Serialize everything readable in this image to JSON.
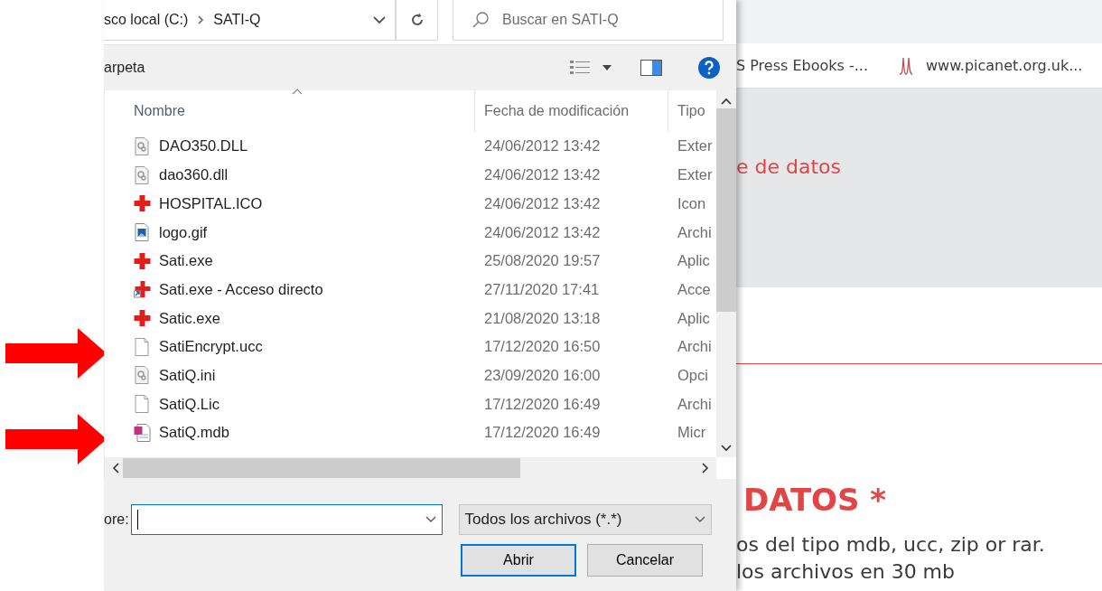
{
  "address_bar": {
    "breadcrumbs": [
      "sco local (C:)",
      "SATI-Q"
    ]
  },
  "search": {
    "placeholder": "Buscar en SATI-Q"
  },
  "toolbar": {
    "label": "arpeta"
  },
  "file_list": {
    "columns": [
      "Nombre",
      "Fecha de modificación",
      "Tipo"
    ],
    "rows": [
      {
        "name": "DAO350.DLL",
        "modified": "24/06/2012 13:42",
        "type": "Exter",
        "kind": "settings-file",
        "marked": false
      },
      {
        "name": "dao360.dll",
        "modified": "24/06/2012 13:42",
        "type": "Exter",
        "kind": "settings-file",
        "marked": false
      },
      {
        "name": "HOSPITAL.ICO",
        "modified": "24/06/2012 13:42",
        "type": "Icon",
        "kind": "cross",
        "marked": false
      },
      {
        "name": "logo.gif",
        "modified": "24/06/2012 13:42",
        "type": "Archi",
        "kind": "image-file",
        "marked": false
      },
      {
        "name": "Sati.exe",
        "modified": "25/08/2020 19:57",
        "type": "Aplic",
        "kind": "cross",
        "marked": false
      },
      {
        "name": "Sati.exe - Acceso directo",
        "modified": "27/11/2020 17:41",
        "type": "Acce",
        "kind": "shortcut",
        "marked": false
      },
      {
        "name": "Satic.exe",
        "modified": "21/08/2020 13:18",
        "type": "Aplic",
        "kind": "cross",
        "marked": false
      },
      {
        "name": "SatiEncrypt.ucc",
        "modified": "17/12/2020 16:50",
        "type": "Archi",
        "kind": "blank-file",
        "marked": true
      },
      {
        "name": "SatiQ.ini",
        "modified": "23/09/2020 16:00",
        "type": "Opci",
        "kind": "settings-file",
        "marked": false
      },
      {
        "name": "SatiQ.Lic",
        "modified": "17/12/2020 16:49",
        "type": "Archi",
        "kind": "blank-file",
        "marked": false
      },
      {
        "name": "SatiQ.mdb",
        "modified": "17/12/2020 16:49",
        "type": "Micr",
        "kind": "database-file",
        "marked": true
      }
    ]
  },
  "file_name": {
    "label": "ore:"
  },
  "file_type": {
    "value": "Todos los archivos (*.*)"
  },
  "buttons": [
    {
      "label": "Abrir",
      "default": true
    },
    {
      "label": "Cancelar",
      "default": false
    }
  ],
  "browser": {
    "bookmarks": [
      {
        "label": "S Press Ebooks -...",
        "icon": false
      },
      {
        "label": "www.picanet.org.uk...",
        "icon": true
      }
    ],
    "banner_title": "e de datos",
    "heading": "DATOS *",
    "paragraph_lines": [
      "os del tipo mdb, ucc, zip or rar.",
      "los archivos en 30 mb"
    ]
  }
}
